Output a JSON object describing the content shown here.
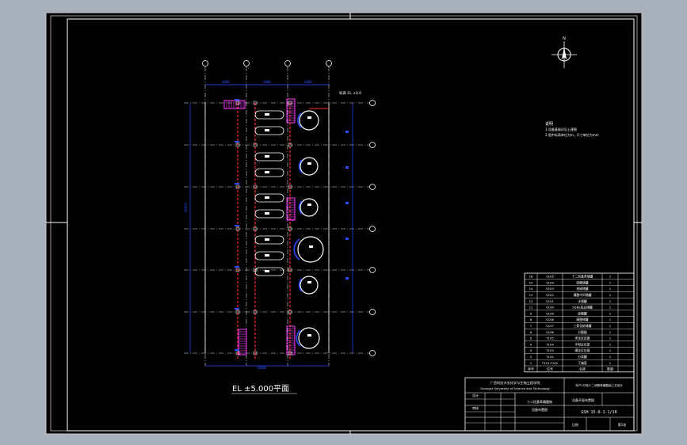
{
  "drawing": {
    "plan_title": "EL ±5.000平面",
    "elevation_note": "标高 EL ±0.0",
    "notes_heading": "说明",
    "notes": [
      "1.设备基础详见土建图",
      "2.图中标高单位为m，尺寸单位为mm"
    ],
    "dimension_top": [
      "6000",
      "6000",
      "6000"
    ],
    "dimension_left": "36000",
    "dimension_bottom": "18000"
  },
  "parts_table": {
    "rows": [
      {
        "no": "16",
        "code": "V105",
        "name": "十二烷基苯储罐",
        "qty": "1"
      },
      {
        "no": "15",
        "code": "V104",
        "name": "硫酸储罐",
        "qty": "1"
      },
      {
        "no": "14",
        "code": "V103",
        "name": "液碱储罐",
        "qty": "1"
      },
      {
        "no": "13",
        "code": "V102",
        "name": "磺酸中间储罐",
        "qty": "1"
      },
      {
        "no": "12",
        "code": "V101",
        "name": "水储罐",
        "qty": "1"
      },
      {
        "no": "11",
        "code": "V100",
        "name": "SDBS成品储罐",
        "qty": "1"
      },
      {
        "no": "9",
        "code": "V109",
        "name": "废酸罐",
        "qty": "1"
      },
      {
        "no": "8",
        "code": "V108",
        "name": "磺酸储罐",
        "qty": "1"
      },
      {
        "no": "7",
        "code": "V107",
        "name": "三氧化硫储罐",
        "qty": "1"
      },
      {
        "no": "6",
        "code": "V106",
        "name": "分酸器",
        "qty": "1"
      },
      {
        "no": "5",
        "code": "T105",
        "name": "老化反应器",
        "qty": "1"
      },
      {
        "no": "4",
        "code": "T104",
        "name": "中和反应釜",
        "qty": "1"
      },
      {
        "no": "3",
        "code": "T103",
        "name": "磺化反应器",
        "qty": "1"
      },
      {
        "no": "2",
        "code": "T102",
        "name": "分离罐",
        "qty": "1"
      },
      {
        "no": "1",
        "code": "T101-T102",
        "name": "干燥塔",
        "qty": "1"
      }
    ],
    "header": {
      "no": "序号",
      "code": "位号",
      "name": "名称",
      "qty": "数量"
    }
  },
  "title_block": {
    "school_cn": "广西科技大学化学与生物工程学院",
    "school_en": "Guangxi University of Science and Technology",
    "project": "年产5万吨十二烷基苯磺酸钠工艺设计",
    "drawing_name": "设备布置图",
    "drawing_no": "GSH 15-0-1-1/10",
    "designer": "设计",
    "checker": "审核",
    "scale": "比例",
    "sheet": "第1张",
    "item_cn": "十二烷基苯磺酸钠",
    "plan": "设备平面布置图"
  },
  "colors": {
    "paper": "#000000",
    "outer": "#a7b0bb",
    "frame": "#ffffff",
    "grid": "#d8d8d8",
    "red": "#ff2a2a",
    "blue": "#2a4bff",
    "magenta": "#ff3dff",
    "white": "#ffffff"
  }
}
